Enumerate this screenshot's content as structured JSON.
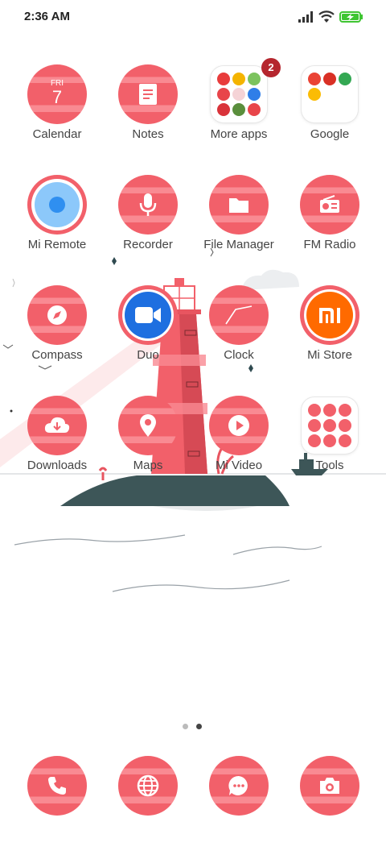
{
  "status_bar": {
    "time": "2:36 AM",
    "icons": [
      "signal-icon",
      "wifi-icon",
      "battery-charging-icon"
    ],
    "battery_color": "#3fc532"
  },
  "home": {
    "apps": [
      {
        "name": "Calendar",
        "icon": "calendar-icon",
        "day": "FRI",
        "date": "7"
      },
      {
        "name": "Notes",
        "icon": "notes-icon"
      },
      {
        "name": "More apps",
        "icon": "folder-icon",
        "badge": "2"
      },
      {
        "name": "Google",
        "icon": "folder-icon"
      },
      {
        "name": "Mi Remote",
        "icon": "remote-icon"
      },
      {
        "name": "Recorder",
        "icon": "microphone-icon"
      },
      {
        "name": "File Manager",
        "icon": "folder-files-icon"
      },
      {
        "name": "FM Radio",
        "icon": "radio-icon"
      },
      {
        "name": "Compass",
        "icon": "compass-icon"
      },
      {
        "name": "Duo",
        "icon": "video-camera-icon"
      },
      {
        "name": "Clock",
        "icon": "clock-icon"
      },
      {
        "name": "Mi Store",
        "icon": "mi-logo-icon"
      },
      {
        "name": "Downloads",
        "icon": "download-cloud-icon"
      },
      {
        "name": "Maps",
        "icon": "map-pin-icon"
      },
      {
        "name": "Mi Video",
        "icon": "play-icon"
      },
      {
        "name": "Tools",
        "icon": "folder-icon"
      }
    ],
    "page_indicator": {
      "pages": 2,
      "current": 2
    }
  },
  "dock": [
    {
      "icon": "phone-icon"
    },
    {
      "icon": "globe-icon"
    },
    {
      "icon": "message-icon"
    },
    {
      "icon": "camera-icon"
    }
  ],
  "theme": {
    "icon_red": "#f2606a",
    "icon_stripe": "#f98a92",
    "duo_blue": "#1e6fe0",
    "mi_orange": "#ff6a00"
  }
}
